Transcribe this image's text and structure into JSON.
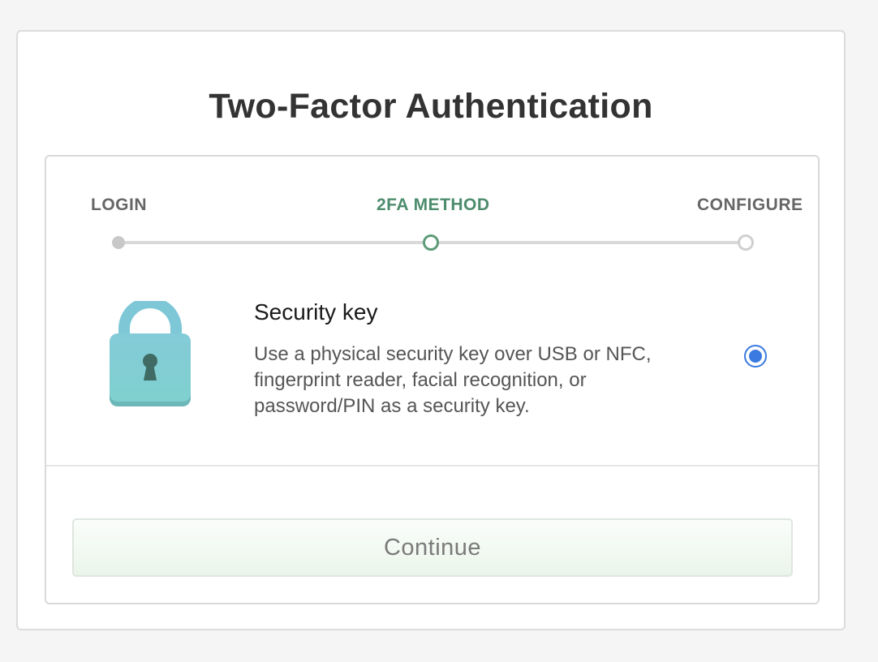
{
  "dialog": {
    "title": "Two-Factor Authentication"
  },
  "stepper": {
    "steps": [
      {
        "label": "LOGIN",
        "state": "completed"
      },
      {
        "label": "2FA METHOD",
        "state": "active"
      },
      {
        "label": "CONFIGURE",
        "state": "upcoming"
      }
    ],
    "colors": {
      "active": "#4d8c6d",
      "completed": "#c8c8c8",
      "track": "#d9d9d9"
    }
  },
  "method": {
    "icon": "lock-icon",
    "title": "Security key",
    "description": "Use a physical security key over USB or NFC, fingerprint reader, facial recognition, or password/PIN as a security key.",
    "selected": true,
    "radio_color": "#3b7ae0"
  },
  "actions": {
    "continue_label": "Continue"
  }
}
